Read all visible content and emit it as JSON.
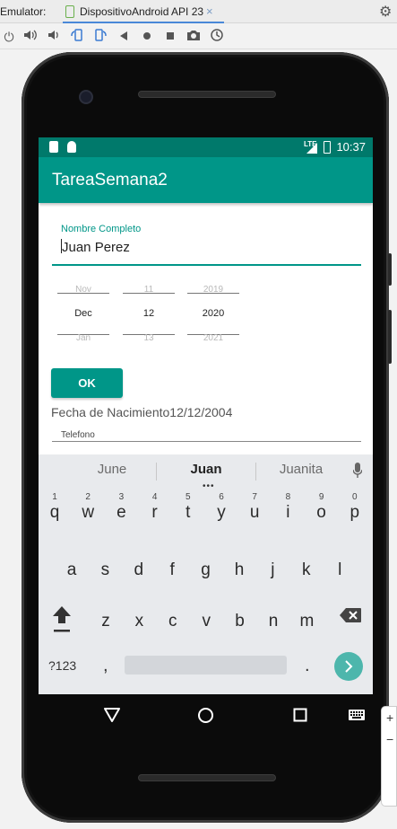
{
  "emulator": {
    "label": "Emulator:",
    "tab_label": "DispositivoAndroid API 23",
    "tab_close": "×",
    "toolbar_icons": [
      "power-icon",
      "volume-up-icon",
      "volume-down-icon",
      "rotate-left-icon",
      "rotate-right-icon",
      "back-icon",
      "home-icon",
      "overview-icon",
      "camera-icon",
      "zoom-history-icon"
    ]
  },
  "statusbar": {
    "time": "10:37",
    "network": "LTE"
  },
  "app": {
    "title": "TareaSemana2",
    "name_field": {
      "label": "Nombre Completo",
      "value": "Juan Perez"
    },
    "date_picker": {
      "months": [
        "Nov",
        "Dec",
        "Jan"
      ],
      "days": [
        "11",
        "12",
        "13"
      ],
      "years": [
        "2019",
        "2020",
        "2021"
      ]
    },
    "ok_label": "OK",
    "fecha_text": "Fecha de Nacimiento12/12/2004",
    "telefono_label": "Telefono"
  },
  "keyboard": {
    "suggestions": [
      "June",
      "Juan",
      "Juanita"
    ],
    "suggestion_dots": "•••",
    "row1": [
      {
        "num": "1",
        "ch": "q"
      },
      {
        "num": "2",
        "ch": "w"
      },
      {
        "num": "3",
        "ch": "e"
      },
      {
        "num": "4",
        "ch": "r"
      },
      {
        "num": "5",
        "ch": "t"
      },
      {
        "num": "6",
        "ch": "y"
      },
      {
        "num": "7",
        "ch": "u"
      },
      {
        "num": "8",
        "ch": "i"
      },
      {
        "num": "9",
        "ch": "o"
      },
      {
        "num": "0",
        "ch": "p"
      }
    ],
    "row2": [
      "a",
      "s",
      "d",
      "f",
      "g",
      "h",
      "j",
      "k",
      "l"
    ],
    "row3": [
      "z",
      "x",
      "c",
      "v",
      "b",
      "n",
      "m"
    ],
    "symbols_label": "?123",
    "comma": ",",
    "period": "."
  },
  "colors": {
    "teal": "#009688",
    "teal_dark": "#00796b",
    "enter": "#4db6ac"
  }
}
